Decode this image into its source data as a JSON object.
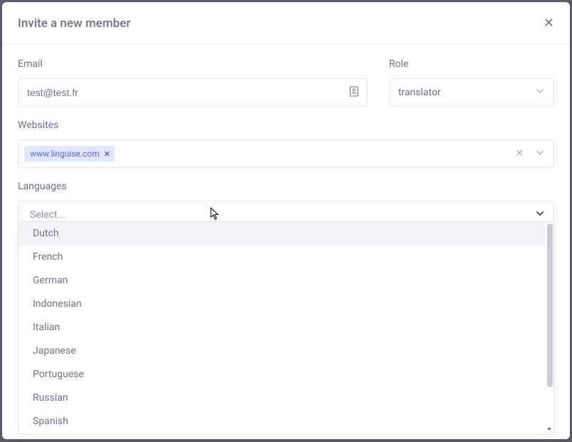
{
  "modal": {
    "title": "Invite a new member"
  },
  "email": {
    "label": "Email",
    "value": "test@test.fr"
  },
  "role": {
    "label": "Role",
    "value": "translator"
  },
  "websites": {
    "label": "Websites",
    "tags": [
      "www.linguise.com"
    ]
  },
  "languages": {
    "label": "Languages",
    "placeholder": "Select...",
    "options": [
      "Dutch",
      "French",
      "German",
      "Indonesian",
      "Italian",
      "Japanese",
      "Portuguese",
      "Russian",
      "Spanish"
    ],
    "highlighted_index": 0
  }
}
